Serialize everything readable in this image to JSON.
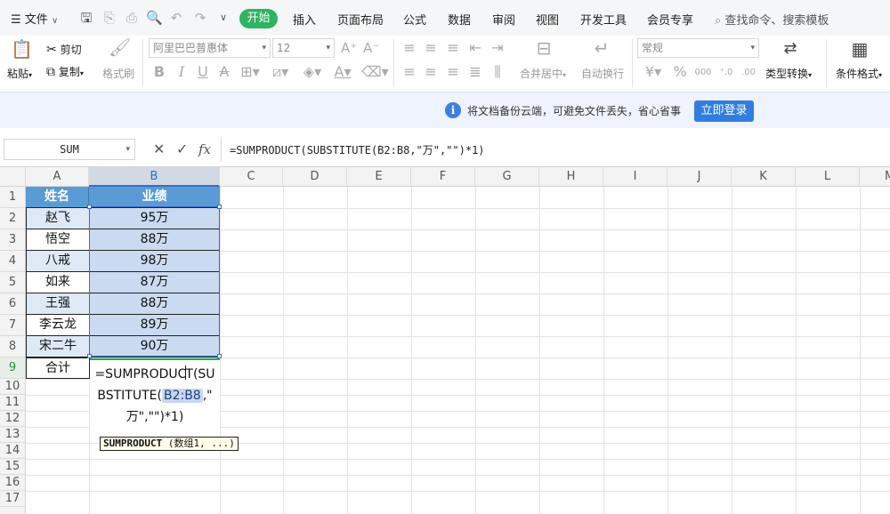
{
  "menubar": {
    "file": "文件",
    "tabs": [
      "开始",
      "插入",
      "页面布局",
      "公式",
      "数据",
      "审阅",
      "视图",
      "开发工具",
      "会员专享"
    ],
    "search_placeholder": "查找命令、搜索模板"
  },
  "ribbon": {
    "paste": "粘贴",
    "cut": "剪切",
    "copy": "复制",
    "format_painter": "格式刷",
    "font_name": "阿里巴巴普惠体",
    "font_size": "12",
    "merge_center": "合并居中",
    "wrap_text": "自动换行",
    "number_format": "常规",
    "convert_type": "类型转换",
    "conditional_format": "条件格式"
  },
  "notice": {
    "text": "将文档备份云端，可避免文件丢失，省心省事",
    "button": "立即登录"
  },
  "formula_bar": {
    "name_box": "SUM",
    "fx": "fx",
    "formula": "=SUMPRODUCT(SUBSTITUTE(B2:B8,\"万\",\"\")*1)"
  },
  "sheet": {
    "columns": [
      "A",
      "B",
      "C",
      "D",
      "E",
      "F",
      "G",
      "H",
      "I",
      "J",
      "K",
      "L",
      "M"
    ],
    "rows": [
      "1",
      "2",
      "3",
      "4",
      "5",
      "6",
      "7",
      "8",
      "9",
      "10",
      "11",
      "12",
      "13",
      "14",
      "15",
      "16",
      "17"
    ],
    "header": [
      "姓名",
      "业绩"
    ],
    "names": [
      "赵飞",
      "悟空",
      "八戒",
      "如来",
      "王强",
      "李云龙",
      "宋二牛"
    ],
    "scores": [
      "95万",
      "88万",
      "98万",
      "87万",
      "88万",
      "89万",
      "90万"
    ],
    "total_label": "合计",
    "edit": {
      "part1": "=SUMPRODUC",
      "part2": "T(SU",
      "part3": "BSTITUTE(",
      "ref": "B2:B8",
      "part4": ",\"",
      "part5": "万\",\"\")*1)"
    },
    "tooltip_fn": "SUMPRODUCT",
    "tooltip_args": " (数组1, ...)"
  }
}
